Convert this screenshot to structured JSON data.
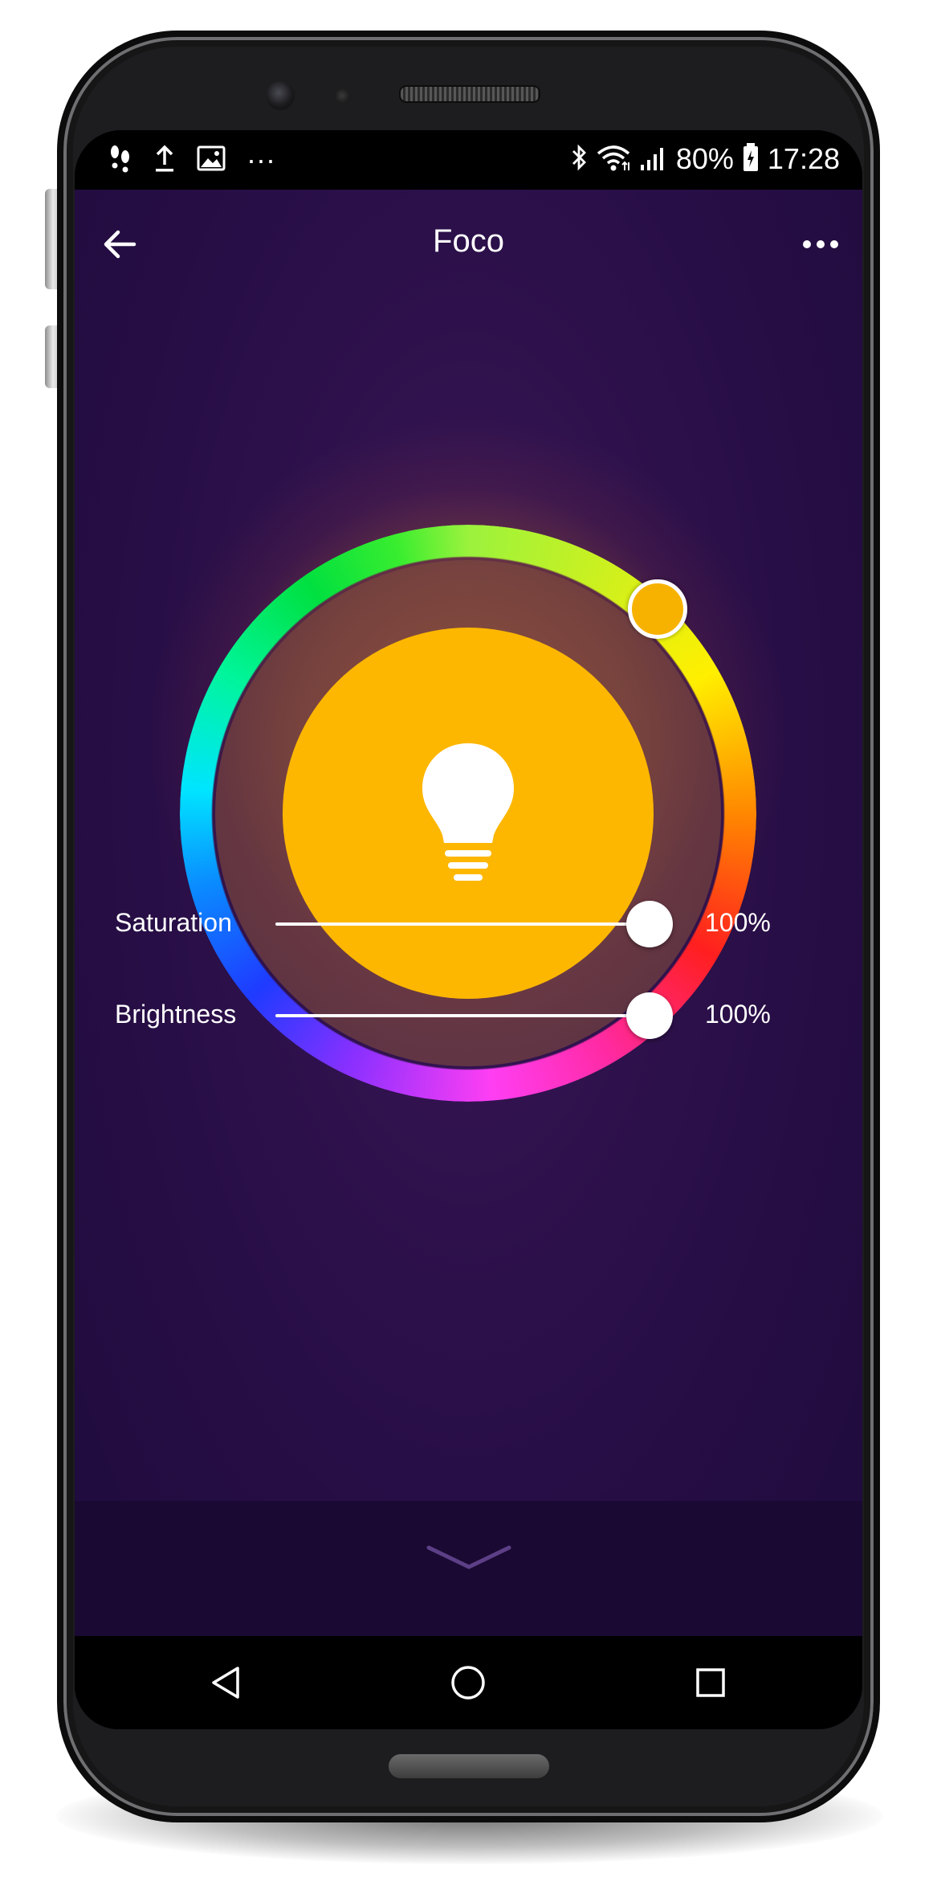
{
  "status_bar": {
    "left_icons": [
      "footprints-icon",
      "upload-icon",
      "image-icon",
      "more-notifications-icon"
    ],
    "right_icons": [
      "bluetooth-icon",
      "wifi-icon",
      "signal-icon",
      "battery-icon"
    ],
    "overflow_glyph": "···",
    "battery": "80%",
    "time": "17:28"
  },
  "header": {
    "title": "Foco",
    "back_icon": "arrow-left-icon",
    "menu_icon": "more-horizontal-icon"
  },
  "color_wheel": {
    "selected_color": "#f7b200",
    "bulb_color": "#fdb700",
    "icon": "lightbulb-icon"
  },
  "sliders": [
    {
      "label": "Saturation",
      "value": "100%",
      "level": 1.0
    },
    {
      "label": "Brightness",
      "value": "100%",
      "level": 1.0
    }
  ],
  "bottom": {
    "icon": "chevron-down-icon"
  },
  "nav_bar": {
    "icons": [
      "back-triangle-icon",
      "home-circle-icon",
      "recents-square-icon"
    ]
  },
  "colors": {
    "background": "#2a0f48",
    "accent": "#fdb700",
    "text": "#ffffff"
  }
}
